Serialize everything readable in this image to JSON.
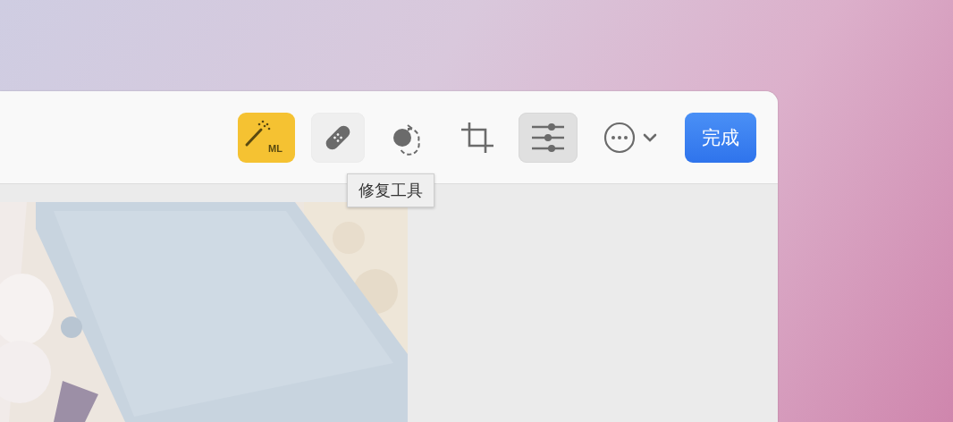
{
  "toolbar": {
    "tools": [
      {
        "kind": "magic",
        "label": "ML",
        "on": true,
        "hovered": false,
        "selected": false
      },
      {
        "kind": "heal",
        "on": false,
        "hovered": true,
        "selected": false
      },
      {
        "kind": "rotate",
        "on": false,
        "hovered": false,
        "selected": false
      },
      {
        "kind": "crop",
        "on": false,
        "hovered": false,
        "selected": false
      },
      {
        "kind": "adjust",
        "on": false,
        "hovered": false,
        "selected": true
      },
      {
        "kind": "more",
        "on": false,
        "hovered": false,
        "selected": false
      }
    ],
    "done_button": "完成"
  },
  "tooltip": "修复工具"
}
